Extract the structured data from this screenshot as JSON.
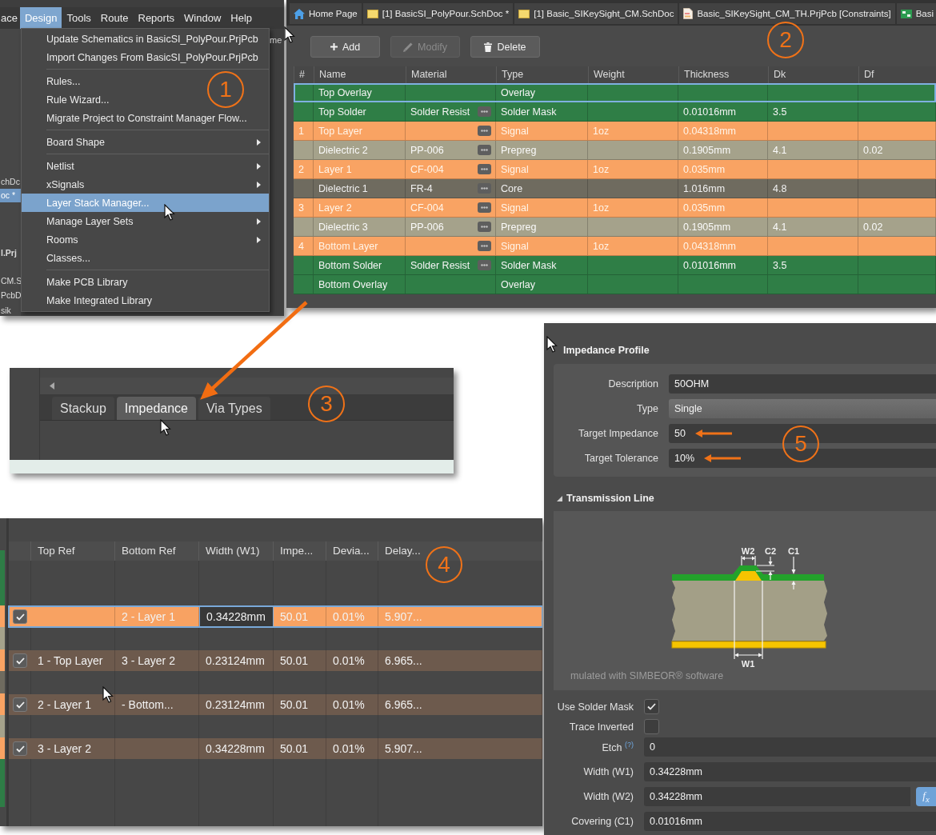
{
  "menu_window": {
    "menubar": [
      {
        "label": "ace",
        "selected": false
      },
      {
        "label": "Design",
        "selected": true
      },
      {
        "label": "Tools",
        "selected": false
      },
      {
        "label": "Route",
        "selected": false
      },
      {
        "label": "Reports",
        "selected": false
      },
      {
        "label": "Window",
        "selected": false
      },
      {
        "label": "Help",
        "selected": false
      }
    ],
    "sidebar_fragments": [
      {
        "text": "chDc",
        "selected": false,
        "active": false
      },
      {
        "text": "oc *",
        "selected": true,
        "active": false
      },
      {
        "text": "l.Prj",
        "selected": false,
        "active": true
      },
      {
        "text": "CM.S",
        "selected": false,
        "active": false
      },
      {
        "text": "PcbD",
        "selected": false,
        "active": false
      },
      {
        "text": "sik",
        "selected": false,
        "active": false
      }
    ],
    "menu_groups": [
      [
        {
          "label": "Update Schematics in BasicSI_PolyPour.PrjPcb",
          "submenu": false,
          "selected": false
        },
        {
          "label": "Import Changes From BasicSI_PolyPour.PrjPcb",
          "submenu": false,
          "selected": false
        }
      ],
      [
        {
          "label": "Rules...",
          "submenu": false,
          "selected": false
        },
        {
          "label": "Rule Wizard...",
          "submenu": false,
          "selected": false
        },
        {
          "label": "Migrate Project to Constraint Manager Flow...",
          "submenu": false,
          "selected": false
        }
      ],
      [
        {
          "label": "Board Shape",
          "submenu": true,
          "selected": false
        }
      ],
      [
        {
          "label": "Netlist",
          "submenu": true,
          "selected": false
        },
        {
          "label": "xSignals",
          "submenu": true,
          "selected": false
        },
        {
          "label": "Layer Stack Manager...",
          "submenu": false,
          "selected": true
        },
        {
          "label": "Manage Layer Sets",
          "submenu": true,
          "selected": false
        },
        {
          "label": "Rooms",
          "submenu": true,
          "selected": false
        },
        {
          "label": "Classes...",
          "submenu": false,
          "selected": false
        }
      ],
      [
        {
          "label": "Make PCB Library",
          "submenu": false,
          "selected": false
        },
        {
          "label": "Make Integrated Library",
          "submenu": false,
          "selected": false
        }
      ]
    ],
    "cut_text": "me"
  },
  "stackup_window": {
    "tabs": [
      {
        "label": "Home Page",
        "kind": "home"
      },
      {
        "label": "[1] BasicSI_PolyPour.SchDoc *",
        "kind": "schematic"
      },
      {
        "label": "[1] Basic_SIKeySight_CM.SchDoc",
        "kind": "schematic"
      },
      {
        "label": "Basic_SIKeySight_CM_TH.PrjPcb [Constraints]",
        "kind": "constraints"
      },
      {
        "label": "Basi",
        "kind": "pcb"
      }
    ],
    "toolbar": [
      {
        "label": "Add",
        "kind": "add",
        "disabled": false
      },
      {
        "label": "Modify",
        "kind": "modify",
        "disabled": true
      },
      {
        "label": "Delete",
        "kind": "delete",
        "disabled": false
      }
    ],
    "table": {
      "columns": [
        "#",
        "Name",
        "Material",
        "Type",
        "Weight",
        "Thickness",
        "Dk",
        "Df"
      ],
      "rows": [
        {
          "kind": "overlay",
          "selected": true,
          "name": "Top Overlay",
          "editor": false,
          "type": "Overlay"
        },
        {
          "kind": "solder_mask",
          "selected": false,
          "name": "Top Solder",
          "material": "Solder Resist",
          "editor": true,
          "type": "Solder Mask",
          "thickness": "0.01016mm",
          "dk": "3.5"
        },
        {
          "kind": "signal",
          "selected": false,
          "number": "1",
          "name": "Top Layer",
          "editor": true,
          "type": "Signal",
          "weight": "1oz",
          "thickness": "0.04318mm"
        },
        {
          "kind": "prepreg",
          "selected": false,
          "name": "Dielectric 2",
          "material": "PP-006",
          "editor": true,
          "type": "Prepreg",
          "thickness": "0.1905mm",
          "dk": "4.1",
          "df": "0.02"
        },
        {
          "kind": "signal",
          "selected": false,
          "number": "2",
          "name": "Layer 1",
          "material": "CF-004",
          "editor": true,
          "type": "Signal",
          "weight": "1oz",
          "thickness": "0.035mm"
        },
        {
          "kind": "core",
          "selected": false,
          "name": "Dielectric 1",
          "material": "FR-4",
          "editor": true,
          "type": "Core",
          "thickness": "1.016mm",
          "dk": "4.8"
        },
        {
          "kind": "signal",
          "selected": false,
          "number": "3",
          "name": "Layer 2",
          "material": "CF-004",
          "editor": true,
          "type": "Signal",
          "weight": "1oz",
          "thickness": "0.035mm"
        },
        {
          "kind": "prepreg",
          "selected": false,
          "name": "Dielectric 3",
          "material": "PP-006",
          "editor": true,
          "type": "Prepreg",
          "thickness": "0.1905mm",
          "dk": "4.1",
          "df": "0.02"
        },
        {
          "kind": "signal",
          "selected": false,
          "number": "4",
          "name": "Bottom Layer",
          "editor": true,
          "type": "Signal",
          "weight": "1oz",
          "thickness": "0.04318mm"
        },
        {
          "kind": "solder_mask",
          "selected": false,
          "name": "Bottom Solder",
          "material": "Solder Resist",
          "editor": true,
          "type": "Solder Mask",
          "thickness": "0.01016mm",
          "dk": "3.5"
        },
        {
          "kind": "overlay",
          "selected": false,
          "name": "Bottom Overlay",
          "editor": false,
          "type": "Overlay"
        }
      ]
    }
  },
  "tabs_window": {
    "tabs": [
      {
        "label": "Stackup",
        "selected": false
      },
      {
        "label": "Impedance",
        "selected": true
      },
      {
        "label": "Via Types",
        "selected": false
      }
    ]
  },
  "impedance_table": {
    "columns": [
      "Top Ref",
      "Bottom Ref",
      "Width (W1)",
      "Impe...",
      "Devia...",
      "Delay..."
    ],
    "rows": [
      {
        "checked": true,
        "selected": true,
        "editing": true,
        "bottom_ref": "2 - Layer 1",
        "width": "0.34228mm",
        "impedance": "50.01",
        "deviation": "0.01%",
        "delay": "5.907..."
      },
      {
        "checked": true,
        "selected": false,
        "editing": false,
        "top_ref": "1 - Top Layer",
        "bottom_ref": "3 - Layer 2",
        "width": "0.23124mm",
        "impedance": "50.01",
        "deviation": "0.01%",
        "delay": "6.965..."
      },
      {
        "checked": true,
        "selected": false,
        "editing": false,
        "top_ref": "2 - Layer 1",
        "bottom_ref": "- Bottom...",
        "width": "0.23124mm",
        "impedance": "50.01",
        "deviation": "0.01%",
        "delay": "6.965..."
      },
      {
        "checked": true,
        "selected": false,
        "editing": false,
        "top_ref": "3 - Layer 2",
        "width": "0.34228mm",
        "impedance": "50.01",
        "deviation": "0.01%",
        "delay": "5.907..."
      }
    ]
  },
  "impedance_profile": {
    "title": "Impedance Profile",
    "fields": [
      {
        "label": "Description",
        "value": "50OHM",
        "kind": "text",
        "flagged": false
      },
      {
        "label": "Type",
        "value": "Single",
        "kind": "dropdown",
        "flagged": false
      },
      {
        "label": "Target Impedance",
        "value": "50",
        "kind": "text",
        "flagged": true
      },
      {
        "label": "Target Tolerance",
        "value": "10%",
        "kind": "text",
        "flagged": true
      }
    ],
    "section": {
      "title": "Transmission Line",
      "expanded": true
    },
    "diagram_labels": [
      "W2",
      "C2",
      "C1",
      "W1"
    ],
    "caption": "mulated with SIMBEOR® software",
    "checkboxes": [
      {
        "label": "Use Solder Mask",
        "checked": true
      },
      {
        "label": "Trace Inverted",
        "checked": false
      }
    ],
    "parameters": [
      {
        "label": "Etch $^{(?)}$",
        "value": "0"
      },
      {
        "label": "Width (W1)",
        "value": "0.34228mm"
      },
      {
        "label": "Width (W2)",
        "value": "0.34228mm",
        "formula": "f$_{x}$"
      },
      {
        "label": "Covering (C1)",
        "value": "0.01016mm"
      }
    ]
  },
  "callouts": [
    "1",
    "2",
    "3",
    "4",
    "5"
  ]
}
